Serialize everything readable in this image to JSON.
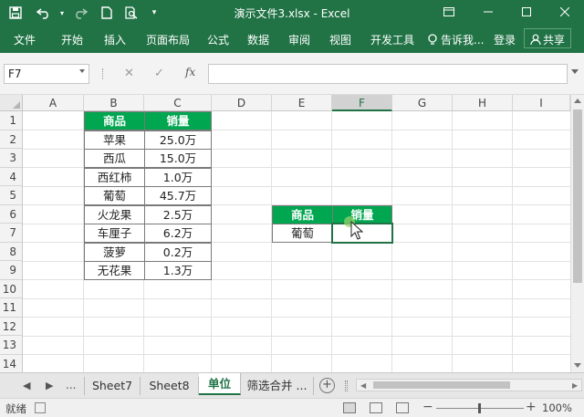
{
  "window": {
    "title": "演示文件3.xlsx - Excel",
    "restore_icon": "ribbon-display-icon",
    "minimize_icon": "minimize-icon",
    "maximize_icon": "maximize-icon",
    "close_icon": "close-icon"
  },
  "quick_access": {
    "save_icon": "save-icon",
    "undo_icon": "undo-icon",
    "redo_icon": "redo-icon",
    "new_icon": "new-file-icon",
    "preview_icon": "print-preview-icon",
    "customize_icon": "customize-qat-icon"
  },
  "ribbon": {
    "tabs": [
      "文件",
      "开始",
      "插入",
      "页面布局",
      "公式",
      "数据",
      "审阅",
      "视图",
      "开发工具"
    ],
    "tell_me": "告诉我...",
    "login": "登录",
    "share": "共享"
  },
  "formula_bar": {
    "name_box": "F7",
    "cancel": "✕",
    "enter": "✓",
    "fx": "fx",
    "value": ""
  },
  "grid": {
    "columns": [
      "A",
      "B",
      "C",
      "D",
      "E",
      "F",
      "G",
      "H",
      "I"
    ],
    "rows": [
      "1",
      "2",
      "3",
      "4",
      "5",
      "6",
      "7",
      "8",
      "9",
      "10",
      "11",
      "12",
      "13",
      "14"
    ],
    "selected_column": "F"
  },
  "table_main": {
    "headers": [
      "商品",
      "销量"
    ],
    "rows": [
      [
        "苹果",
        "25.0万"
      ],
      [
        "西瓜",
        "15.0万"
      ],
      [
        "西红柿",
        "1.0万"
      ],
      [
        "葡萄",
        "45.7万"
      ],
      [
        "火龙果",
        "2.5万"
      ],
      [
        "车厘子",
        "6.2万"
      ],
      [
        "菠萝",
        "0.2万"
      ],
      [
        "无花果",
        "1.3万"
      ]
    ]
  },
  "table_lookup": {
    "headers": [
      "商品",
      "销量"
    ],
    "rows": [
      [
        "葡萄",
        ""
      ]
    ]
  },
  "sheet_tabs": {
    "prev": "◀",
    "next": "▶",
    "more_left": "...",
    "tabs": [
      "Sheet7",
      "Sheet8",
      "单位",
      "筛选合并 ..."
    ],
    "active": "单位",
    "add": "+"
  },
  "status": {
    "text": "就绪",
    "zoom": "100%",
    "zoom_minus": "−",
    "zoom_plus": "+"
  }
}
